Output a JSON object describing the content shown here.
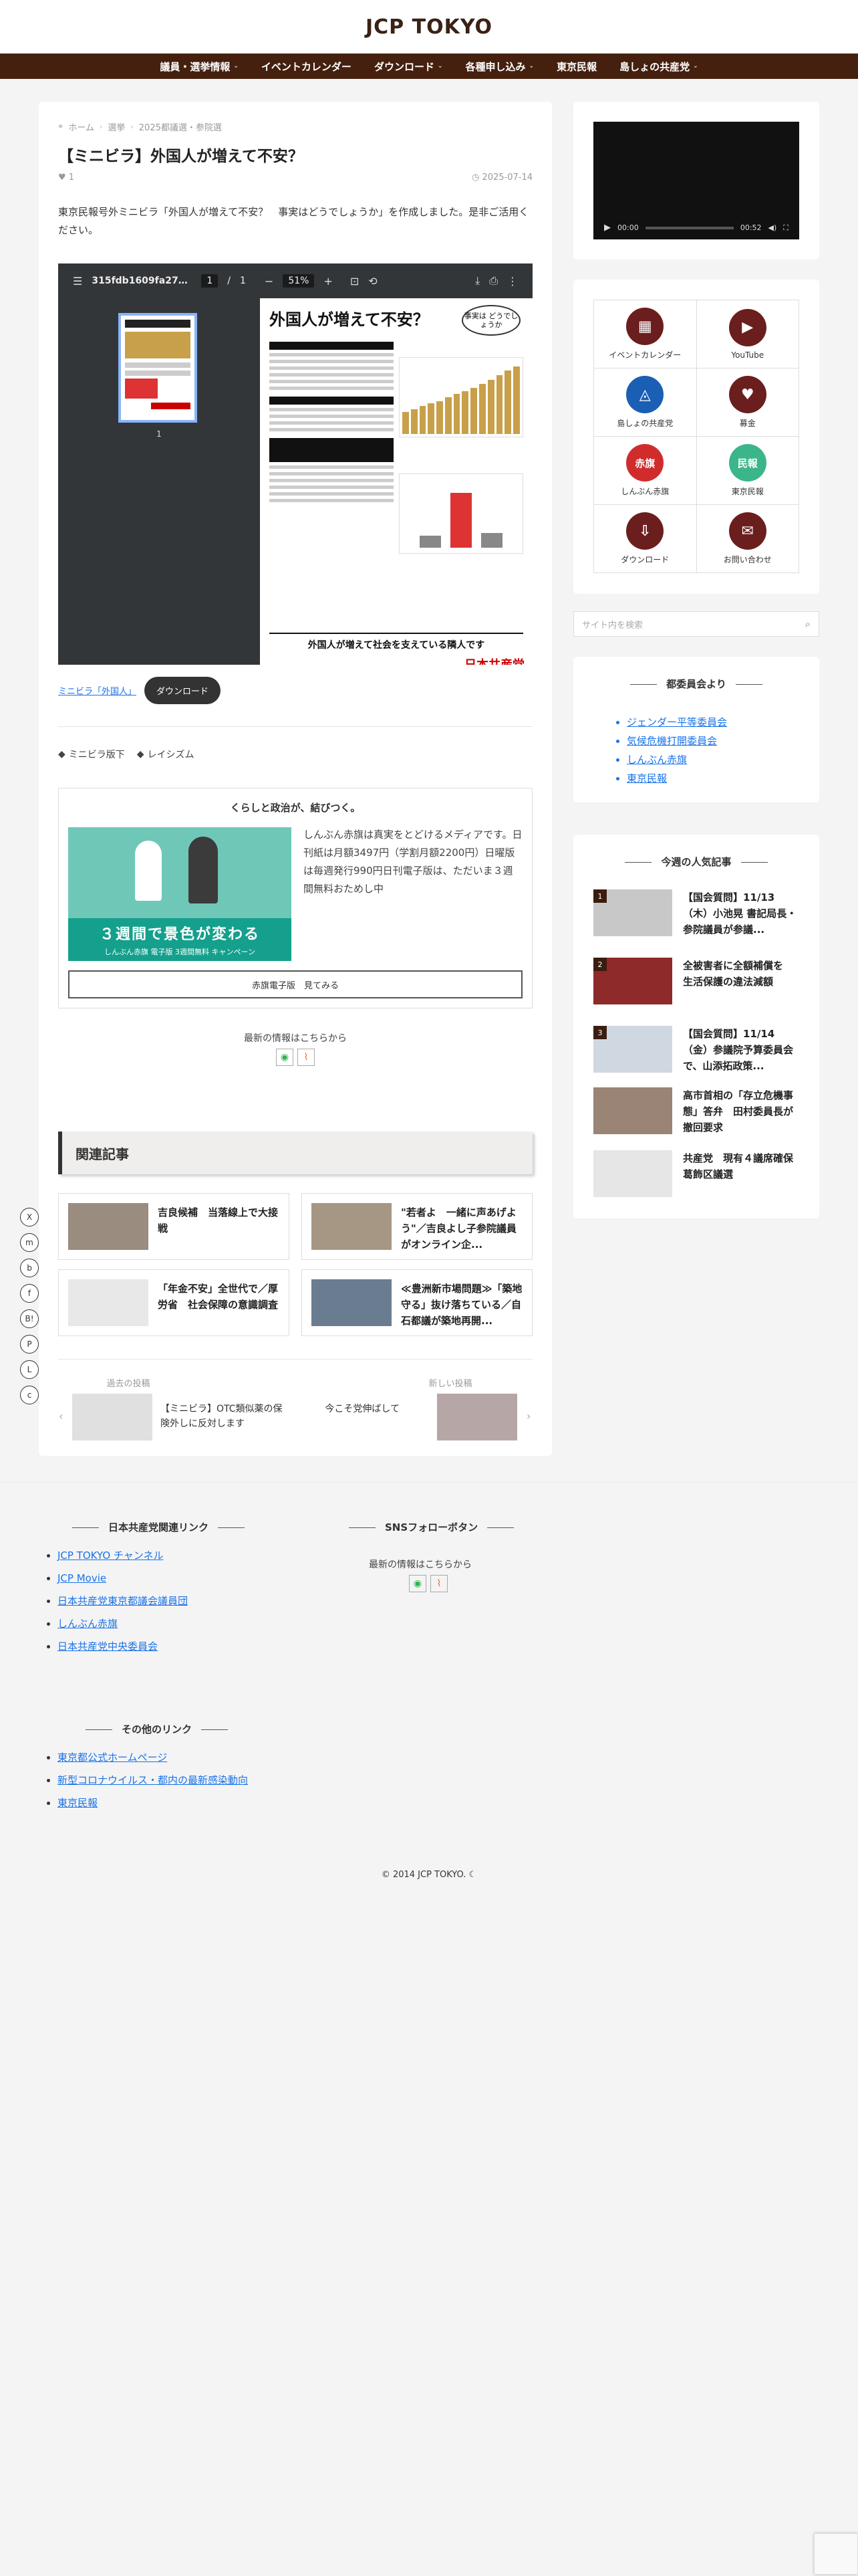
{
  "site": {
    "title": "JCP TOKYO"
  },
  "nav": [
    {
      "label": "議員・選挙情報",
      "caret": "⌄"
    },
    {
      "label": "イベントカレンダー",
      "caret": ""
    },
    {
      "label": "ダウンロード",
      "caret": "⌄"
    },
    {
      "label": "各種申し込み",
      "caret": "⌄"
    },
    {
      "label": "東京民報",
      "caret": ""
    },
    {
      "label": "島しょの共産党",
      "caret": "⌄"
    }
  ],
  "breadcrumb": [
    "ホーム",
    "選挙",
    "2025都議選・参院選"
  ],
  "article": {
    "title": "【ミニビラ】外国人が増えて不安？",
    "likes": "1",
    "date": "2025-07-14",
    "lead": "東京民報号外ミニビラ「外国人が増えて不安？　事実はどうでしょうか」を作成しました。是非ご活用ください。"
  },
  "pdf": {
    "filename": "315fdb1609fa27c1...",
    "page": "1",
    "total": "1",
    "zoom": "51%",
    "thumb_number": "1",
    "flyer_title": "外国人が増えて不安？",
    "flyer_bubble": "事実は どうでしょうか",
    "flyer_section1": "外国人が増えて社会を支えている隣人です",
    "flyer_logo": "日本共産党"
  },
  "pdf_link": "ミニビラ「外国人」",
  "download_label": "ダウンロード",
  "tags": [
    "ミニビラ版下",
    "レイシズム"
  ],
  "promo": {
    "title": "くらしと政治が、結びつく。",
    "desc": "しんぶん赤旗は真実をとどけるメディアです。日刊紙は月額3497円（学割月額2200円）日曜版は毎週発行990円日刊電子版は、ただいま３週間無料おためし中",
    "img_big": "３週間で景色が変わる",
    "img_small": "しんぶん赤旗 電子版 3週間無料 キャンペーン",
    "button": "赤旗電子版　見てみる"
  },
  "follow": {
    "title": "最新の情報はこちらから"
  },
  "related": {
    "heading": "関連記事",
    "items": [
      {
        "title": "吉良候補　当落線上で大接戦"
      },
      {
        "title": "\"若者よ　一緒に声あげよう\"／吉良よし子参院議員がオンライン企..."
      },
      {
        "title": "「年金不安」全世代で／厚労省　社会保障の意識調査"
      },
      {
        "title": "≪豊洲新市場問題≫「築地守る」抜け落ちている／自石都議が築地再開..."
      }
    ]
  },
  "postnav": {
    "prev_label": "過去の投稿",
    "prev_title": "【ミニビラ】OTC類似薬の保険外しに反対します",
    "next_label": "新しい投稿",
    "next_title": "今こそ党伸ばして"
  },
  "video": {
    "current": "00:00",
    "duration": "00:52"
  },
  "icon_links": [
    {
      "label": "イベントカレンダー",
      "icon": "calendar-icon",
      "glyph": "▦",
      "color": "#6b1e1e"
    },
    {
      "label": "YouTube",
      "icon": "youtube-icon",
      "glyph": "▶",
      "color": "#6b1e1e"
    },
    {
      "label": "島しょの共産党",
      "icon": "island-icon",
      "glyph": "◬",
      "color": "#1a5fb4"
    },
    {
      "label": "募金",
      "icon": "heart-hand-icon",
      "glyph": "♥",
      "color": "#6b1e1e"
    },
    {
      "label": "しんぶん赤旗",
      "icon": "akahata-icon",
      "glyph": "赤旗",
      "color": "#d12c2c"
    },
    {
      "label": "東京民報",
      "icon": "minpo-icon",
      "glyph": "民報",
      "color": "#3bb58a"
    },
    {
      "label": "ダウンロード",
      "icon": "download-icon",
      "glyph": "⇩",
      "color": "#6b1e1e"
    },
    {
      "label": "お問い合わせ",
      "icon": "mail-icon",
      "glyph": "✉",
      "color": "#6b1e1e"
    }
  ],
  "search": {
    "placeholder": "サイト内を検索"
  },
  "pref_widget": {
    "title": "都委員会より",
    "items": [
      "ジェンダー平等委員会",
      "気候危機打開委員会",
      "しんぶん赤旗",
      "東京民報"
    ]
  },
  "ranking": {
    "title": "今週の人気記事",
    "items": [
      {
        "num": "1",
        "title": "【国会質問】11/13（木）小池晃 書記局長・参院議員が参議..."
      },
      {
        "num": "2",
        "title": "全被害者に全額補償を　生活保護の違法減額"
      },
      {
        "num": "3",
        "title": "【国会質問】11/14（金）参議院予算委員会で、山添拓政策..."
      },
      {
        "num": "",
        "title": "高市首相の「存立危機事態」答弁　田村委員長が撤回要求"
      },
      {
        "num": "",
        "title": "共産党　現有４議席確保　葛飾区議選"
      }
    ]
  },
  "share": [
    "X",
    "m",
    "b",
    "f",
    "B!",
    "P",
    "L",
    "c"
  ],
  "footer": {
    "col1_title": "日本共産党関連リンク",
    "col1_links": [
      "JCP TOKYO チャンネル",
      "JCP Movie",
      "日本共産党東京都議会議員団",
      "しんぶん赤旗",
      "日本共産党中央委員会"
    ],
    "col2_title": "SNSフォローボタン",
    "col2_text": "最新の情報はこちらから",
    "col3_title": "その他のリンク",
    "col3_links": [
      "東京都公式ホームページ",
      "新型コロナウイルス・都内の最新感染動向",
      "東京民報"
    ],
    "copyright": "© 2014 JCP TOKYO. ☾"
  }
}
